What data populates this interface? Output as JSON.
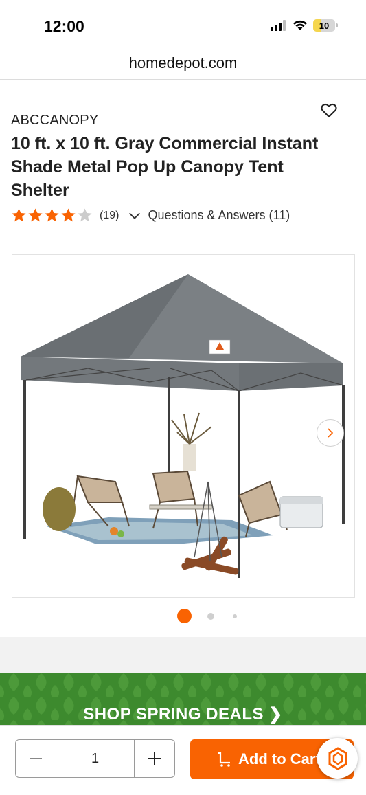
{
  "status_bar": {
    "time": "12:00",
    "battery": "10"
  },
  "browser": {
    "url": "homedepot.com"
  },
  "product": {
    "brand": "ABCCANOPY",
    "title": "10 ft. x 10 ft. Gray Commercial Instant Shade Metal Pop Up Canopy Tent Shelter",
    "rating": 4,
    "rating_max": 5,
    "review_count": "(19)",
    "qa_label": "Questions & Answers (11)"
  },
  "gallery": {
    "image_label": "ABCCANOPY",
    "active_index": 0,
    "dot_count": 3
  },
  "promo": {
    "text": "SHOP SPRING DEALS ❯"
  },
  "purchase": {
    "quantity": "1",
    "add_to_cart_label": "Add to Cart"
  },
  "colors": {
    "accent": "#f96302",
    "promo_green": "#3d8a2e",
    "star_filled": "#f96302",
    "star_empty": "#cccccc",
    "canopy_gray": "#6f7478"
  },
  "icons": {
    "signal": "signal-icon",
    "wifi": "wifi-icon",
    "battery": "battery-icon",
    "wishlist": "heart-icon",
    "qa_toggle": "chevron-down-icon",
    "next_image": "chevron-right-icon",
    "minus": "minus-icon",
    "plus": "plus-icon",
    "cart": "cart-icon",
    "chat": "chat-assistant-icon"
  }
}
